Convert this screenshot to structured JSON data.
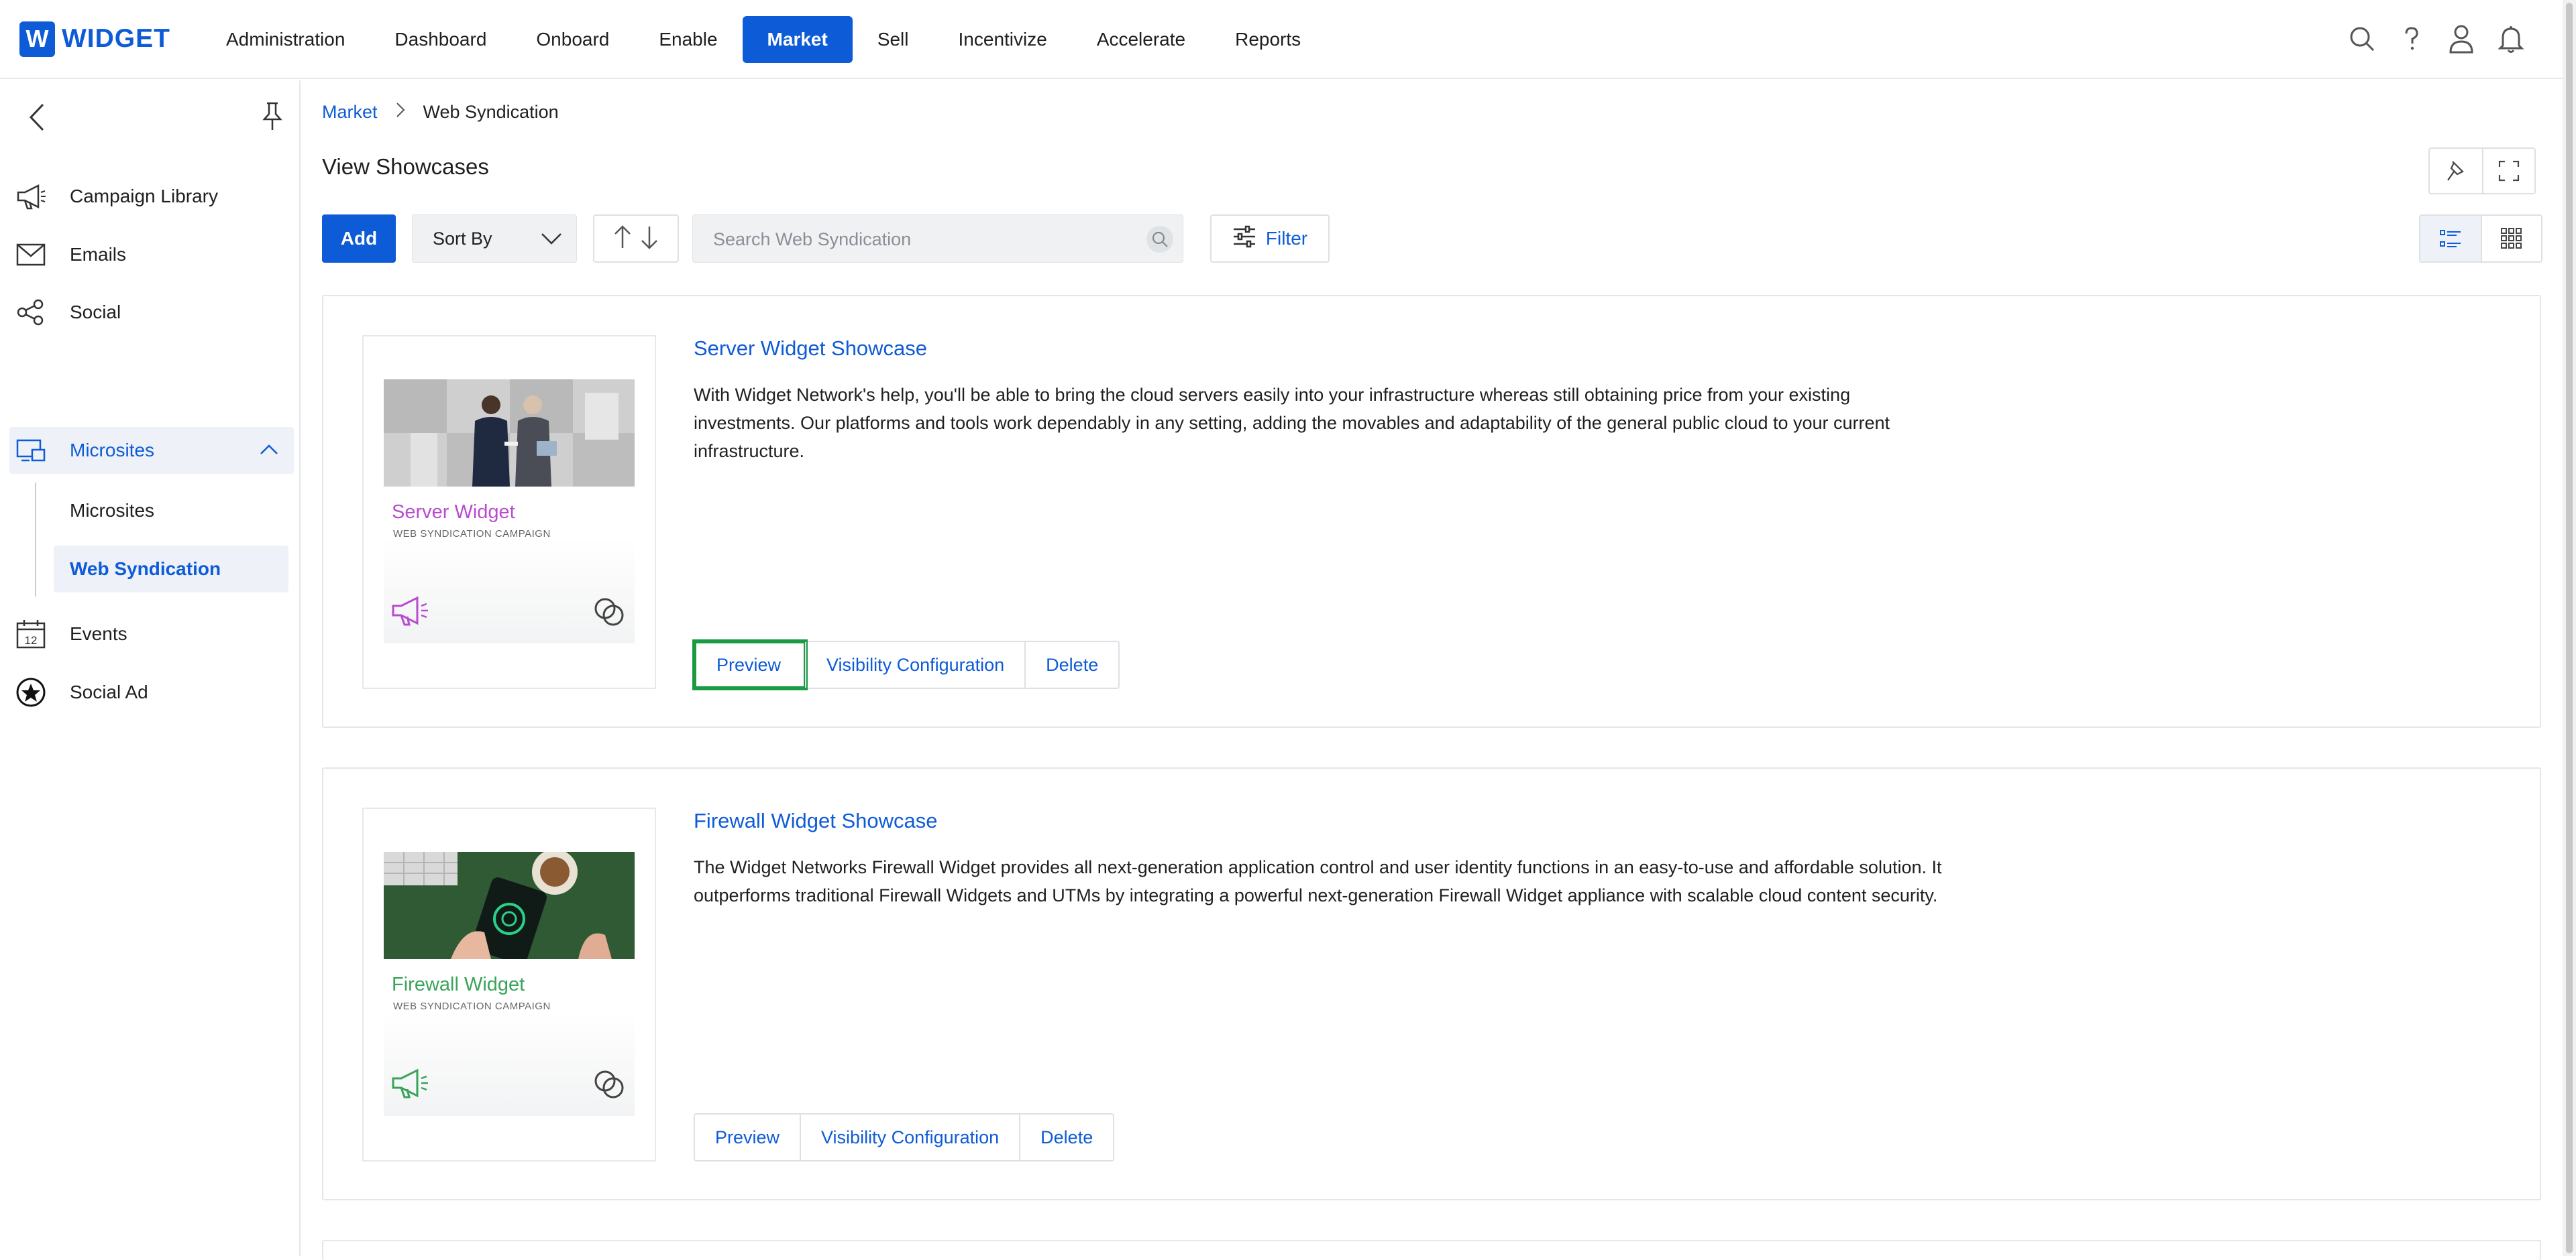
{
  "app": {
    "logo_letter": "W",
    "logo_text": "WIDGET",
    "brand_color": "#0d5bd7"
  },
  "nav": {
    "items": [
      {
        "label": "Administration"
      },
      {
        "label": "Dashboard"
      },
      {
        "label": "Onboard"
      },
      {
        "label": "Enable"
      },
      {
        "label": "Market",
        "active": true
      },
      {
        "label": "Sell"
      },
      {
        "label": "Incentivize"
      },
      {
        "label": "Accelerate"
      },
      {
        "label": "Reports"
      }
    ],
    "icons": [
      "search-icon",
      "help-icon",
      "user-icon",
      "bell-icon"
    ]
  },
  "sidebar": {
    "items": [
      {
        "label": "Campaign Library",
        "icon": "megaphone-icon"
      },
      {
        "label": "Emails",
        "icon": "envelope-icon"
      },
      {
        "label": "Social",
        "icon": "social-icon"
      },
      {
        "label": "Microsites",
        "icon": "microsite-icon",
        "expanded": true
      },
      {
        "label": "Events",
        "icon": "calendar-icon",
        "calendar_day": "12"
      },
      {
        "label": "Social Ad",
        "icon": "star-badge-icon"
      }
    ],
    "sub_items": [
      {
        "label": "Microsites"
      },
      {
        "label": "Web Syndication",
        "active": true
      }
    ]
  },
  "breadcrumb": {
    "parent": "Market",
    "current": "Web Syndication"
  },
  "page": {
    "title": "View Showcases"
  },
  "toolbar": {
    "add_label": "Add",
    "sort_label": "Sort By",
    "search_placeholder": "Search Web Syndication",
    "filter_label": "Filter"
  },
  "showcases": [
    {
      "title": "Server Widget Showcase",
      "description": "With Widget Network's help, you'll be able to bring the cloud servers easily into your infrastructure whereas still obtaining price from your existing investments. Our platforms and tools work dependably in any setting, adding the movables and adaptability of the general public cloud to your current infrastructure.",
      "thumb_name": "Server Widget",
      "thumb_sub": "WEB SYNDICATION CAMPAIGN",
      "thumb_color": "#b94bcf",
      "actions": [
        "Preview",
        "Visibility Configuration",
        "Delete"
      ],
      "highlighted_action": "Preview"
    },
    {
      "title": "Firewall Widget Showcase",
      "description": "The Widget Networks Firewall Widget provides all next-generation application control and user identity functions in an easy-to-use and affordable solution. It outperforms traditional Firewall Widgets and UTMs by integrating a powerful next-generation Firewall Widget appliance with scalable cloud content security.",
      "thumb_name": "Firewall Widget",
      "thumb_sub": "WEB SYNDICATION CAMPAIGN",
      "thumb_color": "#3aa35a",
      "actions": [
        "Preview",
        "Visibility Configuration",
        "Delete"
      ]
    }
  ]
}
